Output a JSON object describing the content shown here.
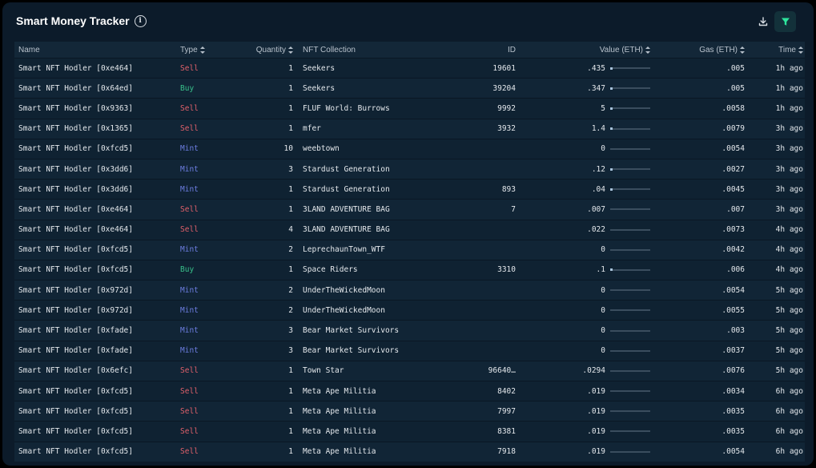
{
  "header": {
    "title": "Smart Money Tracker",
    "info_icon": "info-icon",
    "download_icon": "download-icon",
    "filter_icon": "filter-icon",
    "accent": "#2ee59d"
  },
  "columns": {
    "name": "Name",
    "type": "Type",
    "quantity": "Quantity",
    "collection": "NFT Collection",
    "id": "ID",
    "value": "Value (ETH)",
    "gas": "Gas (ETH)",
    "time": "Time"
  },
  "type_colors": {
    "Sell": "#e0606a",
    "Buy": "#38c08a",
    "Mint": "#6c7de0"
  },
  "rows": [
    {
      "name": "Smart NFT Hodler [0xe464]",
      "type": "Sell",
      "quantity": "1",
      "collection": "Seekers",
      "id": "19601",
      "value": ".435",
      "value_fraction": 0.02,
      "gas": ".005",
      "time": "1h ago"
    },
    {
      "name": "Smart NFT Hodler [0x64ed]",
      "type": "Buy",
      "quantity": "1",
      "collection": "Seekers",
      "id": "39204",
      "value": ".347",
      "value_fraction": 0.02,
      "gas": ".005",
      "time": "1h ago"
    },
    {
      "name": "Smart NFT Hodler [0x9363]",
      "type": "Sell",
      "quantity": "1",
      "collection": "FLUF World: Burrows",
      "id": "9992",
      "value": "5",
      "value_fraction": 0.06,
      "gas": ".0058",
      "time": "1h ago"
    },
    {
      "name": "Smart NFT Hodler [0x1365]",
      "type": "Sell",
      "quantity": "1",
      "collection": "mfer",
      "id": "3932",
      "value": "1.4",
      "value_fraction": 0.02,
      "gas": ".0079",
      "time": "3h ago"
    },
    {
      "name": "Smart NFT Hodler [0xfcd5]",
      "type": "Mint",
      "quantity": "10",
      "collection": "weebtown",
      "id": "",
      "value": "0",
      "value_fraction": 0,
      "gas": ".0054",
      "time": "3h ago"
    },
    {
      "name": "Smart NFT Hodler [0x3dd6]",
      "type": "Mint",
      "quantity": "3",
      "collection": "Stardust Generation",
      "id": "",
      "value": ".12",
      "value_fraction": 0.01,
      "gas": ".0027",
      "time": "3h ago"
    },
    {
      "name": "Smart NFT Hodler [0x3dd6]",
      "type": "Mint",
      "quantity": "1",
      "collection": "Stardust Generation",
      "id": "893",
      "value": ".04",
      "value_fraction": 0.01,
      "gas": ".0045",
      "time": "3h ago"
    },
    {
      "name": "Smart NFT Hodler [0xe464]",
      "type": "Sell",
      "quantity": "1",
      "collection": "3LAND ADVENTURE BAG",
      "id": "7",
      "value": ".007",
      "value_fraction": 0,
      "gas": ".007",
      "time": "3h ago"
    },
    {
      "name": "Smart NFT Hodler [0xe464]",
      "type": "Sell",
      "quantity": "4",
      "collection": "3LAND ADVENTURE BAG",
      "id": "",
      "value": ".022",
      "value_fraction": 0,
      "gas": ".0073",
      "time": "4h ago"
    },
    {
      "name": "Smart NFT Hodler [0xfcd5]",
      "type": "Mint",
      "quantity": "2",
      "collection": "LeprechaunTown_WTF",
      "id": "",
      "value": "0",
      "value_fraction": 0,
      "gas": ".0042",
      "time": "4h ago"
    },
    {
      "name": "Smart NFT Hodler [0xfcd5]",
      "type": "Buy",
      "quantity": "1",
      "collection": "Space Riders",
      "id": "3310",
      "value": ".1",
      "value_fraction": 0.01,
      "gas": ".006",
      "time": "4h ago"
    },
    {
      "name": "Smart NFT Hodler [0x972d]",
      "type": "Mint",
      "quantity": "2",
      "collection": "UnderTheWickedMoon",
      "id": "",
      "value": "0",
      "value_fraction": 0,
      "gas": ".0054",
      "time": "5h ago"
    },
    {
      "name": "Smart NFT Hodler [0x972d]",
      "type": "Mint",
      "quantity": "2",
      "collection": "UnderTheWickedMoon",
      "id": "",
      "value": "0",
      "value_fraction": 0,
      "gas": ".0055",
      "time": "5h ago"
    },
    {
      "name": "Smart NFT Hodler [0xfade]",
      "type": "Mint",
      "quantity": "3",
      "collection": "Bear Market Survivors",
      "id": "",
      "value": "0",
      "value_fraction": 0,
      "gas": ".003",
      "time": "5h ago"
    },
    {
      "name": "Smart NFT Hodler [0xfade]",
      "type": "Mint",
      "quantity": "3",
      "collection": "Bear Market Survivors",
      "id": "",
      "value": "0",
      "value_fraction": 0,
      "gas": ".0037",
      "time": "5h ago"
    },
    {
      "name": "Smart NFT Hodler [0x6efc]",
      "type": "Sell",
      "quantity": "1",
      "collection": "Town Star",
      "id": "96640…",
      "value": ".0294",
      "value_fraction": 0,
      "gas": ".0076",
      "time": "5h ago"
    },
    {
      "name": "Smart NFT Hodler [0xfcd5]",
      "type": "Sell",
      "quantity": "1",
      "collection": "Meta Ape Militia",
      "id": "8402",
      "value": ".019",
      "value_fraction": 0,
      "gas": ".0034",
      "time": "6h ago"
    },
    {
      "name": "Smart NFT Hodler [0xfcd5]",
      "type": "Sell",
      "quantity": "1",
      "collection": "Meta Ape Militia",
      "id": "7997",
      "value": ".019",
      "value_fraction": 0,
      "gas": ".0035",
      "time": "6h ago"
    },
    {
      "name": "Smart NFT Hodler [0xfcd5]",
      "type": "Sell",
      "quantity": "1",
      "collection": "Meta Ape Militia",
      "id": "8381",
      "value": ".019",
      "value_fraction": 0,
      "gas": ".0035",
      "time": "6h ago"
    },
    {
      "name": "Smart NFT Hodler [0xfcd5]",
      "type": "Sell",
      "quantity": "1",
      "collection": "Meta Ape Militia",
      "id": "7918",
      "value": ".019",
      "value_fraction": 0,
      "gas": ".0054",
      "time": "6h ago"
    }
  ]
}
